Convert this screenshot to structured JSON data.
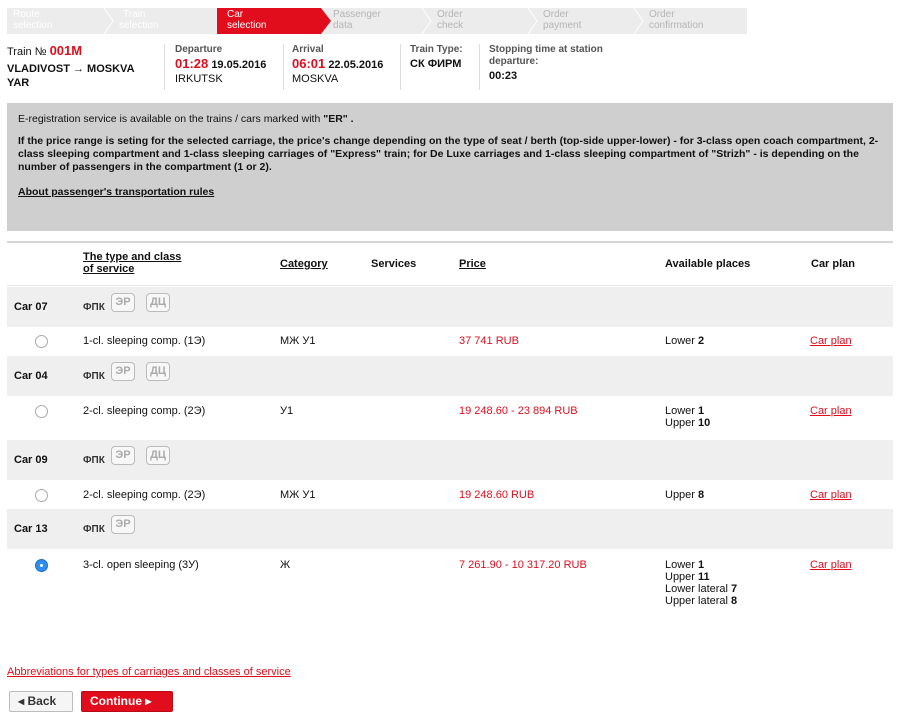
{
  "steps": [
    {
      "label1": "Route",
      "label2": "selection",
      "state": "done"
    },
    {
      "label1": "Train",
      "label2": "selection",
      "state": "done"
    },
    {
      "label1": "Car",
      "label2": "selection",
      "state": "active"
    },
    {
      "label1": "Passenger",
      "label2": "data",
      "state": "future"
    },
    {
      "label1": "Order",
      "label2": "check",
      "state": "future"
    },
    {
      "label1": "Order",
      "label2": "payment",
      "state": "future"
    },
    {
      "label1": "Order",
      "label2": "confirmation",
      "state": "future"
    }
  ],
  "train": {
    "no_label": "Train №",
    "no_value": "001M",
    "route": "VLADIVOST → MOSKVA YAR",
    "departure_label": "Departure",
    "departure_time": "01:28",
    "departure_date": "19.05.2016",
    "departure_station": "IRKUTSK",
    "arrival_label": "Arrival",
    "arrival_time": "06:01",
    "arrival_date": "22.05.2016",
    "arrival_station": "MOSKVA",
    "type_label": "Train Type:",
    "type_value": "СК ФИРМ",
    "stop_label1": "Stopping time at station",
    "stop_label2": "departure:",
    "stop_value": "00:23"
  },
  "notice": {
    "line1_a": "E-registration service is available on the trains / cars marked with ",
    "line1_b": "\"ER\" .",
    "para2": "If the price range is seting for the selected carriage, the price's change depending on the type of seat / berth (top-side upper-lower) - for 3-class open coach compartment, 2-class sleeping compartment and 1-class sleeping carriages of \"Express\" train; for De Luxe carriages and 1-class sleeping compartment of \"Strizh\" - is depending on the number of passengers in the compartment (1 or 2).",
    "rules_link": "About passenger's transportation rules"
  },
  "table": {
    "headers": {
      "type1": "The type and class",
      "type2": "of service",
      "category": "Category",
      "services": "Services",
      "price": "Price",
      "available": "Available places",
      "carplan": "Car plan"
    },
    "cars": [
      {
        "car": "Car 07",
        "org": "ФПК",
        "tags": [
          "ЭР",
          "ДЦ"
        ],
        "type": "1-cl. sleeping comp. (1Э)",
        "category": "МЖ У1",
        "price": "37 741 RUB",
        "places": [
          {
            "label": "Lower",
            "count": "2"
          }
        ],
        "carplan": "Car plan",
        "selected": false
      },
      {
        "car": "Car 04",
        "org": "ФПК",
        "tags": [
          "ЭР",
          "ДЦ"
        ],
        "type": "2-cl. sleeping comp. (2Э)",
        "category": "У1",
        "price": "19 248.60 - 23 894 RUB",
        "places": [
          {
            "label": "Lower",
            "count": "1"
          },
          {
            "label": "Upper",
            "count": "10"
          }
        ],
        "carplan": "Car plan",
        "selected": false
      },
      {
        "car": "Car 09",
        "org": "ФПК",
        "tags": [
          "ЭР",
          "ДЦ"
        ],
        "type": "2-cl. sleeping comp. (2Э)",
        "category": "МЖ У1",
        "price": "19 248.60 RUB",
        "places": [
          {
            "label": "Upper",
            "count": "8"
          }
        ],
        "carplan": "Car plan",
        "selected": false
      },
      {
        "car": "Car 13",
        "org": "ФПК",
        "tags": [
          "ЭР"
        ],
        "type": "3-cl. open sleeping (3У)",
        "category": "Ж",
        "price": "7 261.90 - 10 317.20 RUB",
        "places": [
          {
            "label": "Lower",
            "count": "1"
          },
          {
            "label": "Upper",
            "count": "11"
          },
          {
            "label": "Lower lateral",
            "count": "7"
          },
          {
            "label": "Upper lateral",
            "count": "8"
          }
        ],
        "carplan": "Car plan",
        "selected": true
      }
    ]
  },
  "footer": {
    "abbr_link": "Abbreviations for types of carriages and classes of service",
    "back": "Back",
    "continue": "Continue"
  },
  "colors": {
    "accent": "#e10d1c",
    "notice_bg": "#cfcfcf",
    "group_bg": "#efefef",
    "radio_on": "#2f8eea"
  }
}
